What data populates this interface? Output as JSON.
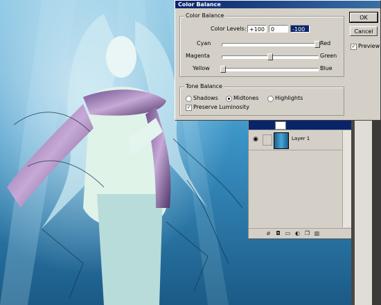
{
  "dialog": {
    "title": "Color Balance",
    "color_balance_group": "Color Balance",
    "color_levels_label": "Color Levels:",
    "level_1": "+100",
    "level_2": "0",
    "level_3": "-100",
    "sliders": [
      {
        "left": "Cyan",
        "right": "Red",
        "value": 100
      },
      {
        "left": "Magenta",
        "right": "Green",
        "value": 0
      },
      {
        "left": "Yellow",
        "right": "Blue",
        "value": -100
      }
    ],
    "tone_balance_group": "Tone Balance",
    "tones": {
      "shadows": "Shadows",
      "midtones": "Midtones",
      "highlights": "Highlights"
    },
    "selected_tone": "Midtones",
    "preserve_luminosity": "Preserve Luminosity",
    "ok_label": "OK",
    "cancel_label": "Cancel",
    "preview_label": "Preview"
  },
  "layers": {
    "items": [
      {
        "name": "",
        "selected": true
      },
      {
        "name": "Layer 1",
        "selected": false
      }
    ]
  },
  "colors": {
    "titlebar": "#0a246a",
    "canvas_blue": "#2a7fb8"
  }
}
